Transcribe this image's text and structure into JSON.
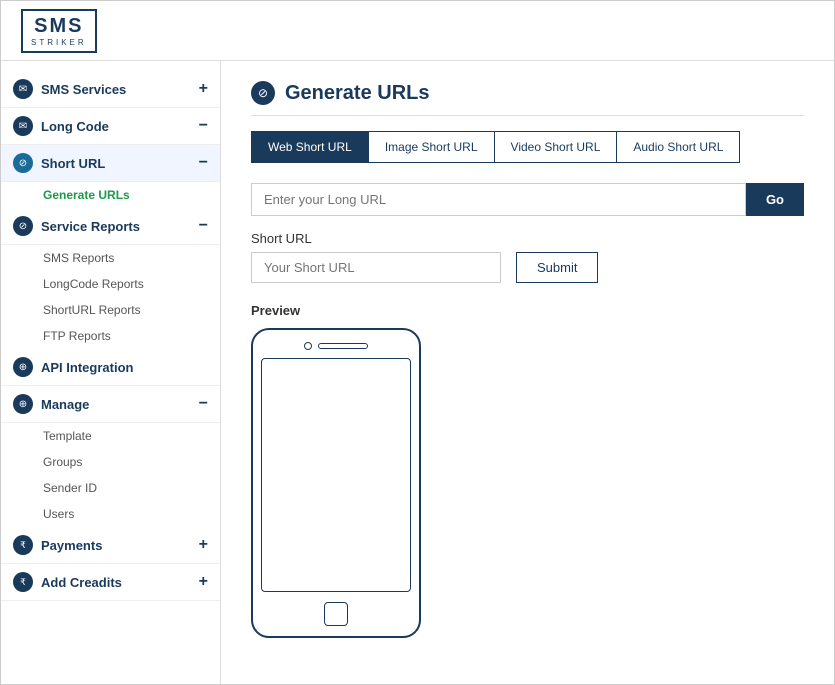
{
  "app": {
    "logo_sms": "SMS",
    "logo_striker": "STRIKER"
  },
  "sidebar": {
    "items": [
      {
        "id": "sms-services",
        "label": "SMS Services",
        "icon": "✉",
        "toggle": "+",
        "expanded": false
      },
      {
        "id": "long-code",
        "label": "Long Code",
        "icon": "✉",
        "toggle": "−",
        "expanded": true
      },
      {
        "id": "short-url",
        "label": "Short URL",
        "icon": "⊘",
        "toggle": "−",
        "expanded": true,
        "active": true,
        "sub_items": [
          {
            "id": "generate-urls",
            "label": "Generate URLs",
            "active": true
          }
        ]
      },
      {
        "id": "service-reports",
        "label": "Service Reports",
        "icon": "⊘",
        "toggle": "−",
        "expanded": true,
        "sub_items": [
          {
            "id": "sms-reports",
            "label": "SMS Reports"
          },
          {
            "id": "longcode-reports",
            "label": "LongCode Reports"
          },
          {
            "id": "shorturl-reports",
            "label": "ShortURL Reports"
          },
          {
            "id": "ftp-reports",
            "label": "FTP Reports"
          }
        ]
      },
      {
        "id": "api-integration",
        "label": "API Integration",
        "icon": "⊕",
        "toggle": "",
        "expanded": false
      },
      {
        "id": "manage",
        "label": "Manage",
        "icon": "⊕",
        "toggle": "−",
        "expanded": true,
        "sub_items": [
          {
            "id": "template",
            "label": "Template"
          },
          {
            "id": "groups",
            "label": "Groups"
          },
          {
            "id": "sender-id",
            "label": "Sender ID"
          },
          {
            "id": "users",
            "label": "Users"
          }
        ]
      },
      {
        "id": "payments",
        "label": "Payments",
        "icon": "₹",
        "toggle": "+",
        "expanded": false
      },
      {
        "id": "add-credits",
        "label": "Add Creadits",
        "icon": "₹",
        "toggle": "+",
        "expanded": false
      }
    ]
  },
  "content": {
    "page_title": "Generate URLs",
    "tabs": [
      {
        "id": "web-short-url",
        "label": "Web Short URL",
        "active": true
      },
      {
        "id": "image-short-url",
        "label": "Image Short URL",
        "active": false
      },
      {
        "id": "video-short-url",
        "label": "Video Short URL",
        "active": false
      },
      {
        "id": "audio-short-url",
        "label": "Audio Short URL",
        "active": false
      }
    ],
    "url_input_placeholder": "Enter your Long URL",
    "go_button_label": "Go",
    "short_url_label": "Short URL",
    "short_url_placeholder": "Your Short URL",
    "submit_button_label": "Submit",
    "preview_label": "Preview"
  }
}
